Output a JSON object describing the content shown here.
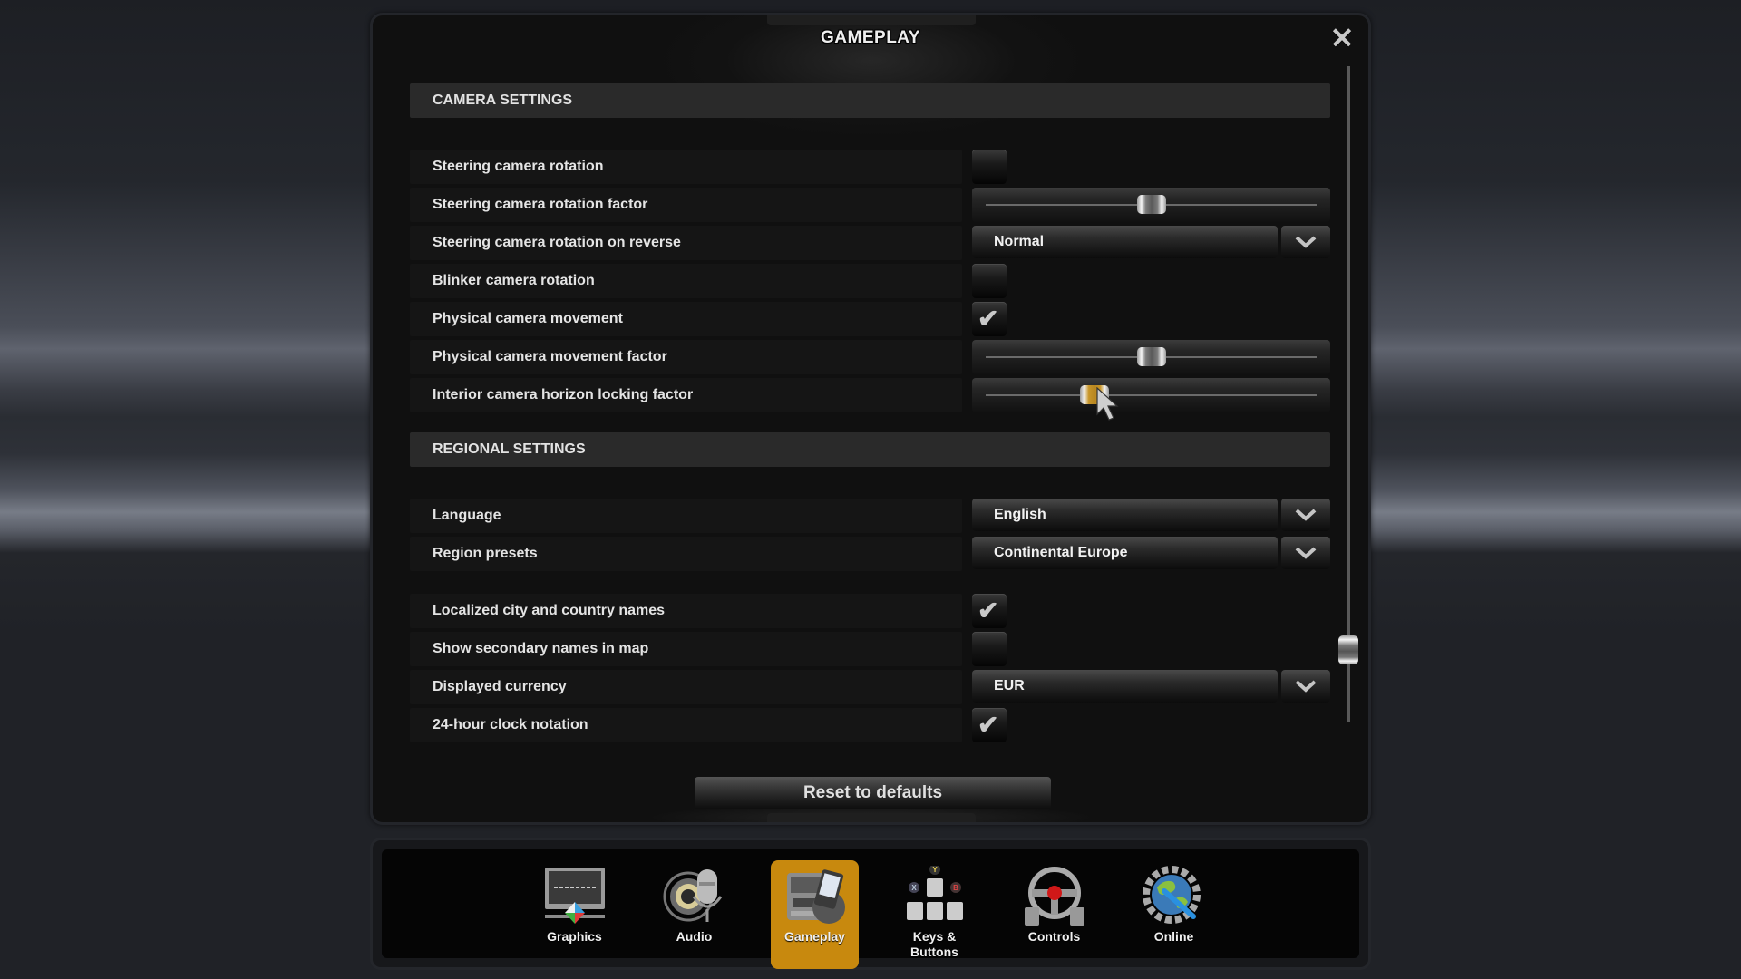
{
  "dialog": {
    "title": "GAMEPLAY",
    "close_icon": "close-icon",
    "scroll_position": 0.89
  },
  "sections": {
    "camera": {
      "title": "CAMERA SETTINGS",
      "rows": [
        {
          "label": "Steering camera rotation",
          "control": "checkbox",
          "checked": false
        },
        {
          "label": "Steering camera rotation factor",
          "control": "slider",
          "value": 0.5
        },
        {
          "label": "Steering camera rotation on reverse",
          "control": "dropdown",
          "value": "Normal"
        },
        {
          "label": "Blinker camera rotation",
          "control": "checkbox",
          "checked": false
        },
        {
          "label": "Physical camera movement",
          "control": "checkbox",
          "checked": true
        },
        {
          "label": "Physical camera movement factor",
          "control": "slider",
          "value": 0.5
        },
        {
          "label": "Interior camera horizon locking factor",
          "control": "slider",
          "value": 0.33,
          "active": true
        }
      ]
    },
    "regional": {
      "title": "REGIONAL SETTINGS",
      "rows": [
        {
          "label": "Language",
          "control": "dropdown",
          "value": "English"
        },
        {
          "label": "Region presets",
          "control": "dropdown",
          "value": "Continental Europe"
        },
        {
          "label": "Localized city and country names",
          "control": "checkbox",
          "checked": true
        },
        {
          "label": "Show secondary names in map",
          "control": "checkbox",
          "checked": false
        },
        {
          "label": "Displayed currency",
          "control": "dropdown",
          "value": "EUR"
        },
        {
          "label": "24-hour clock notation",
          "control": "checkbox",
          "checked": true
        }
      ]
    }
  },
  "reset_button": {
    "label": "Reset to defaults"
  },
  "nav": {
    "items": [
      {
        "label": "Graphics",
        "icon": "graphics-monitor-icon",
        "active": false
      },
      {
        "label": "Audio",
        "icon": "audio-speaker-microphone-icon",
        "active": false
      },
      {
        "label": "Gameplay",
        "icon": "gameplay-truck-icon",
        "active": true
      },
      {
        "label": "Keys &\nButtons",
        "icon": "keys-buttons-icon",
        "active": false
      },
      {
        "label": "Controls",
        "icon": "steering-wheel-icon",
        "active": false
      },
      {
        "label": "Online",
        "icon": "online-globe-gear-icon",
        "active": false
      }
    ]
  },
  "colors": {
    "accent_gold": "#c8890e",
    "slider_active": "#c8962a",
    "panel_bg": "#101010",
    "section_header_bg": "#2a2a2a"
  }
}
